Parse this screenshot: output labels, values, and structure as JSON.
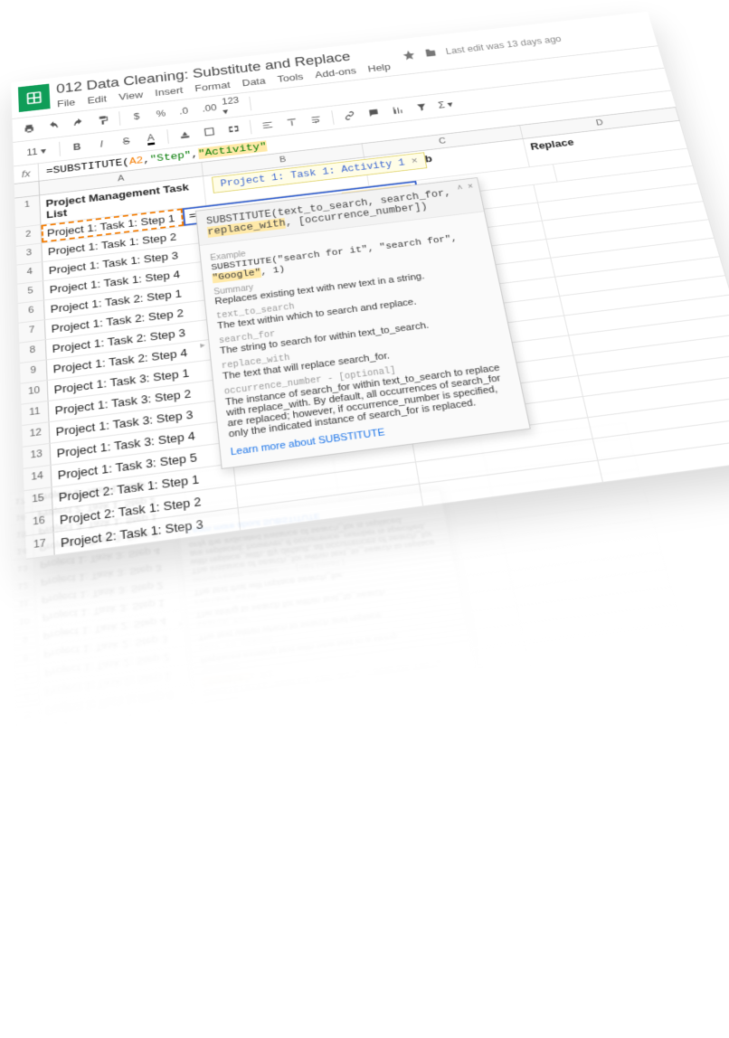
{
  "doc_title": "012 Data Cleaning: Substitute and Replace",
  "menus": [
    "File",
    "Edit",
    "View",
    "Insert",
    "Format",
    "Data",
    "Tools",
    "Add-ons",
    "Help"
  ],
  "last_edit": "Last edit was 13 days ago",
  "toolbar2": {
    "fontsize": "11"
  },
  "formula": {
    "fn": "=SUBSTITUTE(",
    "ref": "A2",
    "sep": ",",
    "str1": "\"Step\"",
    "str2": "\"Activity\""
  },
  "columns": [
    "A",
    "B",
    "C",
    "D"
  ],
  "headers": {
    "A": "Project Management Task List",
    "C": "IF with Sub",
    "D": "Replace"
  },
  "preview": "Project 1: Task 1: Activity 1",
  "editing": {
    "fn": "=SUBSTITUTE(",
    "ref": "A2",
    "sep": ",",
    "str1": "\"Step\"",
    "str2": "\"Activity\""
  },
  "colA": [
    "Project 1: Task 1: Step 1",
    "Project 1: Task 1: Step 2",
    "Project 1: Task 1: Step 3",
    "Project 1: Task 1: Step 4",
    "Project 1: Task 2: Step 1",
    "Project 1: Task 2: Step 2",
    "Project 1: Task 2: Step 3",
    "Project 1: Task 2: Step 4",
    "Project 1: Task 3: Step 1",
    "Project 1: Task 3: Step 2",
    "Project 1: Task 3: Step 3",
    "Project 1: Task 3: Step 4",
    "Project 1: Task 3: Step 5",
    "Project 2: Task 1: Step 1",
    "Project 2: Task 1: Step 2",
    "Project 2: Task 1: Step 3"
  ],
  "help": {
    "sig_pre": "SUBSTITUTE(text_to_search, search_for, ",
    "sig_hl": "replace_with",
    "sig_post": ", [occurrence_number])",
    "example_lab": "Example",
    "example_txt_pre": "SUBSTITUTE(\"search for it\", \"search for\", ",
    "example_hl": "\"Google\"",
    "example_txt_post": ", 1)",
    "summary_lab": "Summary",
    "summary_txt": "Replaces existing text with new text in a string.",
    "p1_lab": "text_to_search",
    "p1_txt": "The text within which to search and replace.",
    "p2_lab": "search_for",
    "p2_txt": "The string to search for within text_to_search.",
    "p3_lab": "replace_with",
    "p3_txt": "The text that will replace search_for.",
    "p4_lab": "occurrence_number - [optional]",
    "p4_txt": "The instance of search_for within text_to_search to replace with replace_with. By default, all occurrences of search_for are replaced; however, if occurrence_number is specified, only the indicated instance of search_for is replaced.",
    "learn": "Learn more about SUBSTITUTE"
  }
}
